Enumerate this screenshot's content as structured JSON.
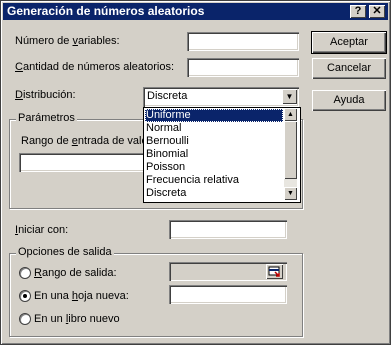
{
  "dialog": {
    "title": "Generación de números aleatorios",
    "help_glyph": "?",
    "close_glyph": "✕"
  },
  "fields": {
    "num_variables_label_pre": "Número de ",
    "num_variables_label_u": "v",
    "num_variables_label_post": "ariables:",
    "cantidad_label_pre": "",
    "cantidad_label_u": "C",
    "cantidad_label_post": "antidad de números aleatorios:",
    "distribucion_label_pre": "",
    "distribucion_label_u": "D",
    "distribucion_label_post": "istribución:",
    "distribucion_value": "Discreta",
    "iniciar_label_pre": "",
    "iniciar_label_u": "I",
    "iniciar_label_post": "niciar con:"
  },
  "buttons": {
    "aceptar": "Aceptar",
    "cancelar": "Cancelar",
    "ayuda": "Ayuda"
  },
  "parametros": {
    "legend": "Parámetros",
    "rango_label_pre": "Rango de ",
    "rango_label_u": "e",
    "rango_label_post": "ntrada de valo"
  },
  "dropdown": {
    "options": [
      "Uniforme",
      "Normal",
      "Bernoulli",
      "Binomial",
      "Poisson",
      "Frecuencia relativa",
      "Discreta"
    ],
    "selected_index": 0
  },
  "salida": {
    "legend": "Opciones de salida",
    "rango_salida_pre": "",
    "rango_salida_u": "R",
    "rango_salida_post": "ango de salida:",
    "hoja_nueva_pre": "En una ",
    "hoja_nueva_u": "h",
    "hoja_nueva_post": "oja nueva:",
    "libro_nuevo_pre": "En un ",
    "libro_nuevo_u": "l",
    "libro_nuevo_post": "ibro nuevo",
    "selected": "hoja_nueva"
  },
  "icons": {
    "ref_collapse": "collapse-dialog-icon"
  }
}
